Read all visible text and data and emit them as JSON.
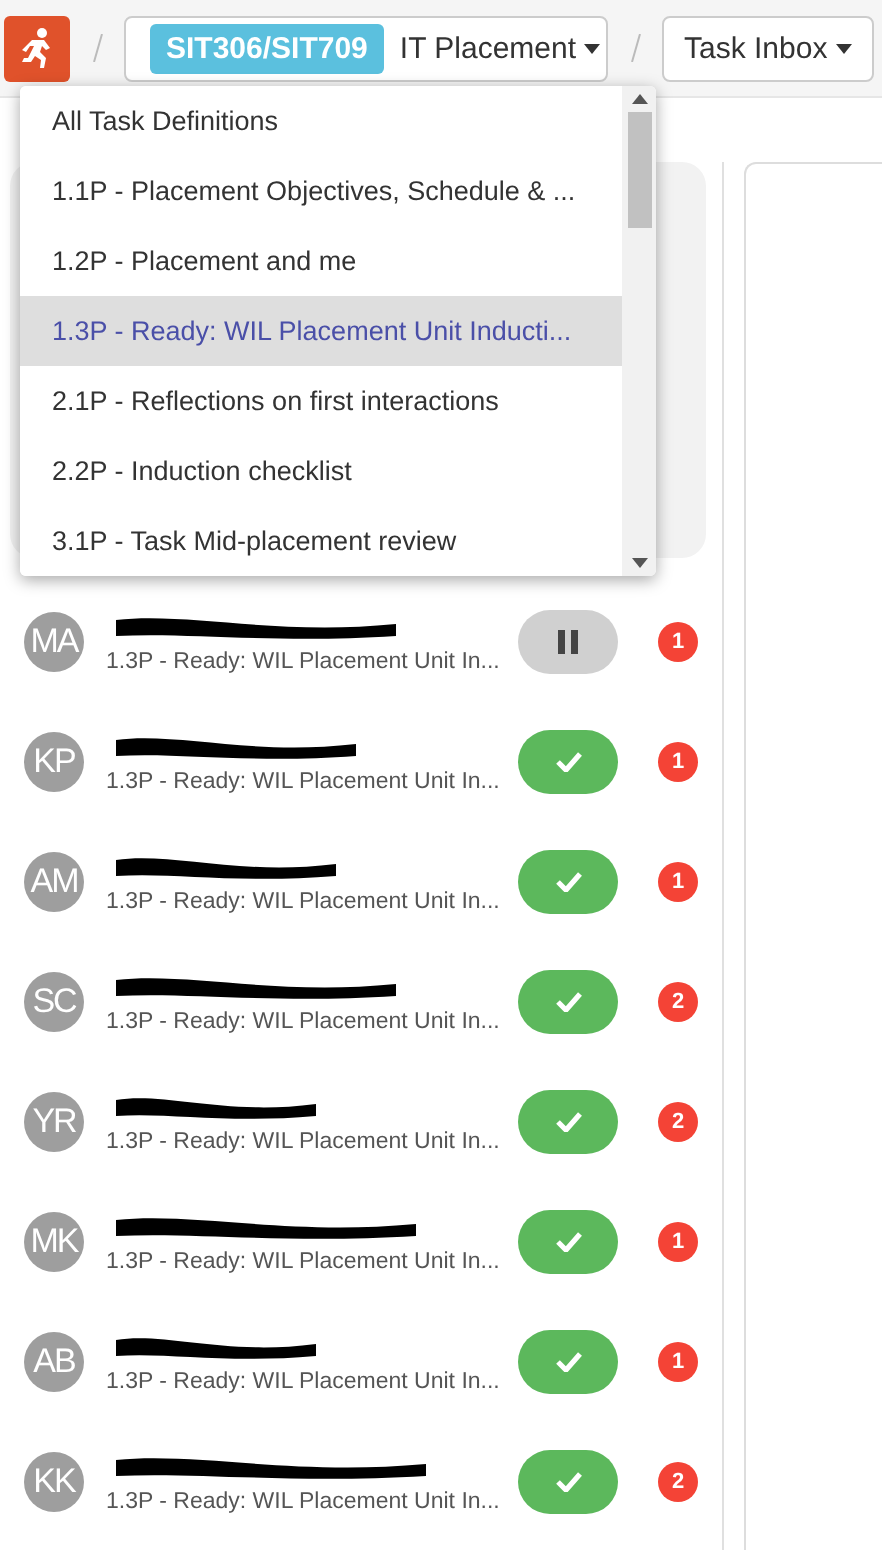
{
  "header": {
    "unit_code": "SIT306/SIT709",
    "unit_name": "IT Placement",
    "view": "Task Inbox"
  },
  "task_menu": {
    "open": true,
    "items": [
      {
        "label": "All Task Definitions",
        "selected": false
      },
      {
        "label": "1.1P - Placement Objectives, Schedule & ...",
        "selected": false
      },
      {
        "label": "1.2P - Placement and me",
        "selected": false
      },
      {
        "label": "1.3P - Ready: WIL Placement Unit Inducti...",
        "selected": true
      },
      {
        "label": "2.1P - Reflections on first interactions",
        "selected": false
      },
      {
        "label": "2.2P - Induction checklist",
        "selected": false
      },
      {
        "label": "3.1P - Task Mid-placement review",
        "selected": false
      }
    ]
  },
  "submissions": [
    {
      "initials": "MA",
      "task": "1.3P - Ready: WIL Placement Unit In...",
      "paused": true,
      "count": "1"
    },
    {
      "initials": "KP",
      "task": "1.3P - Ready: WIL Placement Unit In...",
      "paused": false,
      "count": "1"
    },
    {
      "initials": "AM",
      "task": "1.3P - Ready: WIL Placement Unit In...",
      "paused": false,
      "count": "1"
    },
    {
      "initials": "SC",
      "task": "1.3P - Ready: WIL Placement Unit In...",
      "paused": false,
      "count": "2"
    },
    {
      "initials": "YR",
      "task": "1.3P - Ready: WIL Placement Unit In...",
      "paused": false,
      "count": "2"
    },
    {
      "initials": "MK",
      "task": "1.3P - Ready: WIL Placement Unit In...",
      "paused": false,
      "count": "1"
    },
    {
      "initials": "AB",
      "task": "1.3P - Ready: WIL Placement Unit In...",
      "paused": false,
      "count": "1"
    },
    {
      "initials": "KK",
      "task": "1.3P - Ready: WIL Placement Unit In...",
      "paused": false,
      "count": "2"
    }
  ]
}
